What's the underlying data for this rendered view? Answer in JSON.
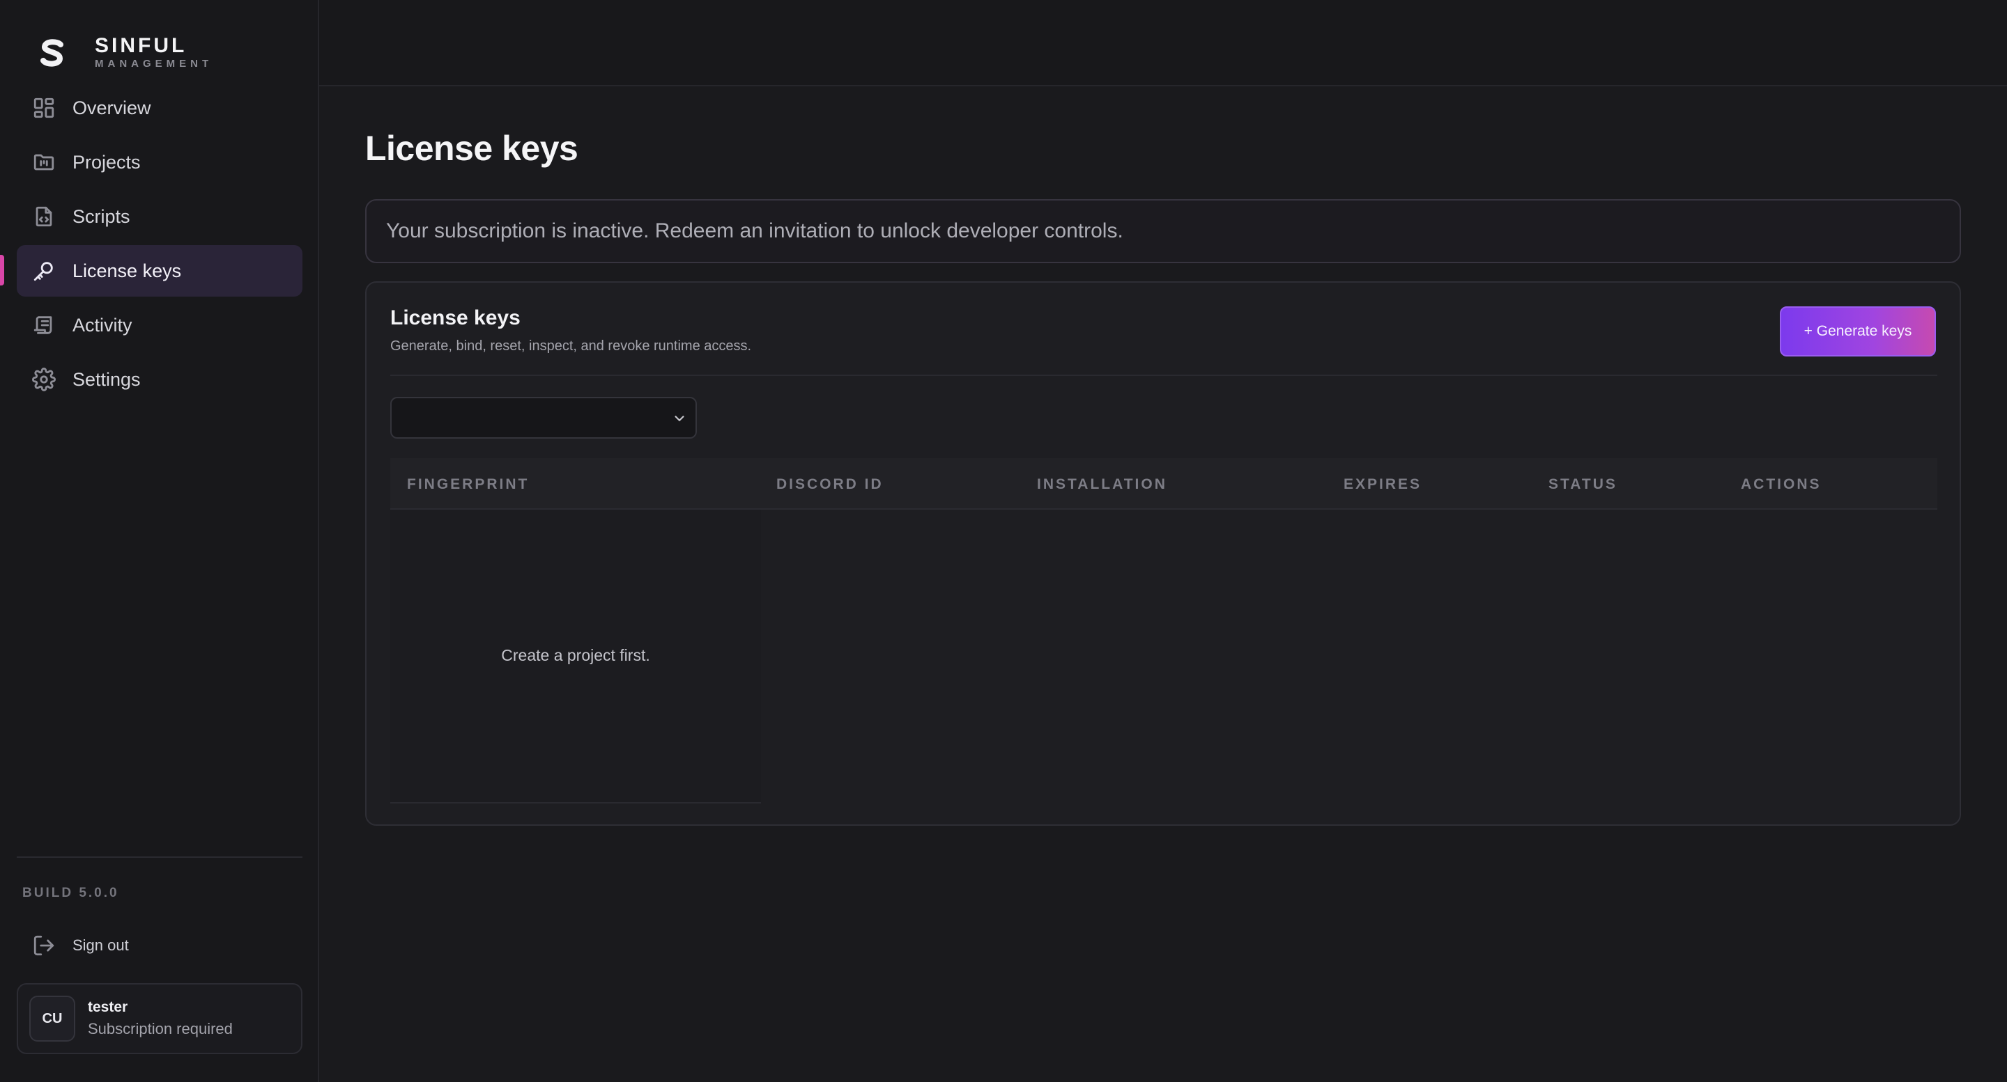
{
  "brand": {
    "name": "SINFUL",
    "subtitle": "MANAGEMENT"
  },
  "sidebar": {
    "items": [
      {
        "label": "Overview",
        "icon": "grid-icon",
        "active": false
      },
      {
        "label": "Projects",
        "icon": "folder-icon",
        "active": false
      },
      {
        "label": "Scripts",
        "icon": "file-code-icon",
        "active": false
      },
      {
        "label": "License keys",
        "icon": "key-icon",
        "active": true
      },
      {
        "label": "Activity",
        "icon": "scroll-icon",
        "active": false
      },
      {
        "label": "Settings",
        "icon": "gear-icon",
        "active": false
      }
    ],
    "build": "BUILD 5.0.0",
    "sign_out": "Sign out"
  },
  "user": {
    "initials": "CU",
    "name": "tester",
    "status": "Subscription required"
  },
  "main": {
    "title": "License keys",
    "alert": "Your subscription is inactive. Redeem an invitation to unlock developer controls.",
    "panel": {
      "title": "License keys",
      "subtitle": "Generate, bind, reset, inspect, and revoke runtime access.",
      "generate_button": "+ Generate keys",
      "project_select": {
        "value": ""
      },
      "table": {
        "columns": [
          "FINGERPRINT",
          "DISCORD ID",
          "INSTALLATION",
          "EXPIRES",
          "STATUS",
          "ACTIONS"
        ],
        "rows": [],
        "empty_message": "Create a project first."
      }
    }
  },
  "colors": {
    "accent": "#7c3aed",
    "accent_end": "#c64ab0",
    "active_indicator": "#d946a8",
    "background": "#18181b"
  }
}
